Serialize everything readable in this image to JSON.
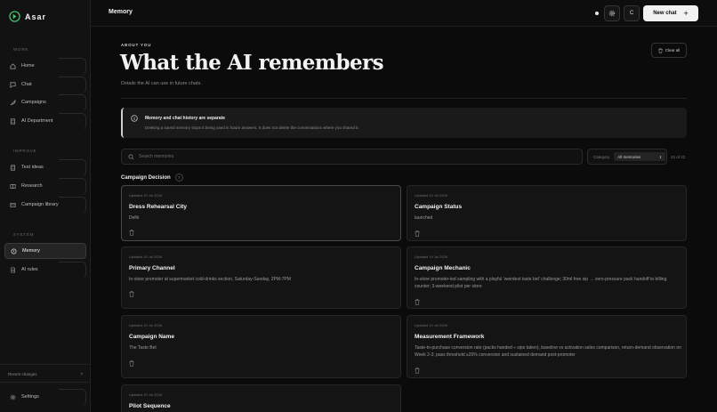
{
  "app": {
    "name": "Asar"
  },
  "sidebar": {
    "sections": [
      {
        "label": "WORK",
        "items": [
          {
            "label": "Home",
            "icon": "home-icon"
          },
          {
            "label": "Chat",
            "icon": "chat-icon"
          },
          {
            "label": "Campaigns",
            "icon": "rocket-icon"
          },
          {
            "label": "AI Department",
            "icon": "building-icon"
          }
        ]
      },
      {
        "label": "IMPROVE",
        "items": [
          {
            "label": "Test ideas",
            "icon": "flask-icon"
          },
          {
            "label": "Research",
            "icon": "book-icon"
          },
          {
            "label": "Campaign library",
            "icon": "library-icon"
          }
        ]
      },
      {
        "label": "SYSTEM",
        "items": [
          {
            "label": "Memory",
            "icon": "memory-icon",
            "active": true
          },
          {
            "label": "AI rules",
            "icon": "rules-icon"
          }
        ]
      }
    ],
    "recent_changes": {
      "label": "Recent changes",
      "count": "7"
    },
    "settings_label": "Settings"
  },
  "header": {
    "page_name": "Memory",
    "profile_initial": "C",
    "new_chat_label": "New chat",
    "new_chat_icon": "+"
  },
  "main": {
    "eyebrow": "ABOUT YOU",
    "title": "What the AI remembers",
    "subtitle": "Details the AI can use in future chats.",
    "clear_all_label": "Clear all",
    "notice": {
      "title": "Memory and chat history are separate",
      "text": "Deleting a saved memory stops it being used in future answers. It does not delete the conversations where you shared it."
    },
    "search": {
      "placeholder": "Search memories",
      "value": ""
    },
    "category": {
      "label": "Category",
      "selected": "All memories"
    },
    "count_label": "22 of 22",
    "group": {
      "title": "Campaign Decision",
      "count": "7"
    },
    "cards": [
      {
        "date": "Updated 19 Jul 2026",
        "title": "Dress Rehearsal City",
        "value": "Delhi"
      },
      {
        "date": "Updated 19 Jul 2026",
        "title": "Campaign Status",
        "value": "launched"
      },
      {
        "date": "Updated 19 Jul 2026",
        "title": "Primary Channel",
        "value": "In-store promoter at supermarket cold-drinks section, Saturday-Sunday, 2PM-7PM"
      },
      {
        "date": "Updated 19 Jul 2026",
        "title": "Campaign Mechanic",
        "value": "In-store promoter-led sampling with a playful 'weirdest taste bet' challenge; 30ml free sip → zero-pressure pack handoff to billing counter; 3-weekend pilot per store"
      },
      {
        "date": "Updated 19 Jul 2026",
        "title": "Campaign Name",
        "value": "The Taste Bet"
      },
      {
        "date": "Updated 19 Jul 2026",
        "title": "Measurement Framework",
        "value": "Taste-to-purchase conversion rate (packs handed ÷ sips taken), baseline vs activation sales comparison, return-demand observation on Week 2-3; pass threshold ≥25% conversion and sustained demand post-promoter"
      },
      {
        "date": "Updated 19 Jul 2026",
        "title": "Pilot Sequence",
        "value": ""
      }
    ]
  },
  "colors": {
    "background": "#0b0b0b",
    "sidebar": "#121212",
    "card": "#141414",
    "accent": "#f2f2f2"
  }
}
